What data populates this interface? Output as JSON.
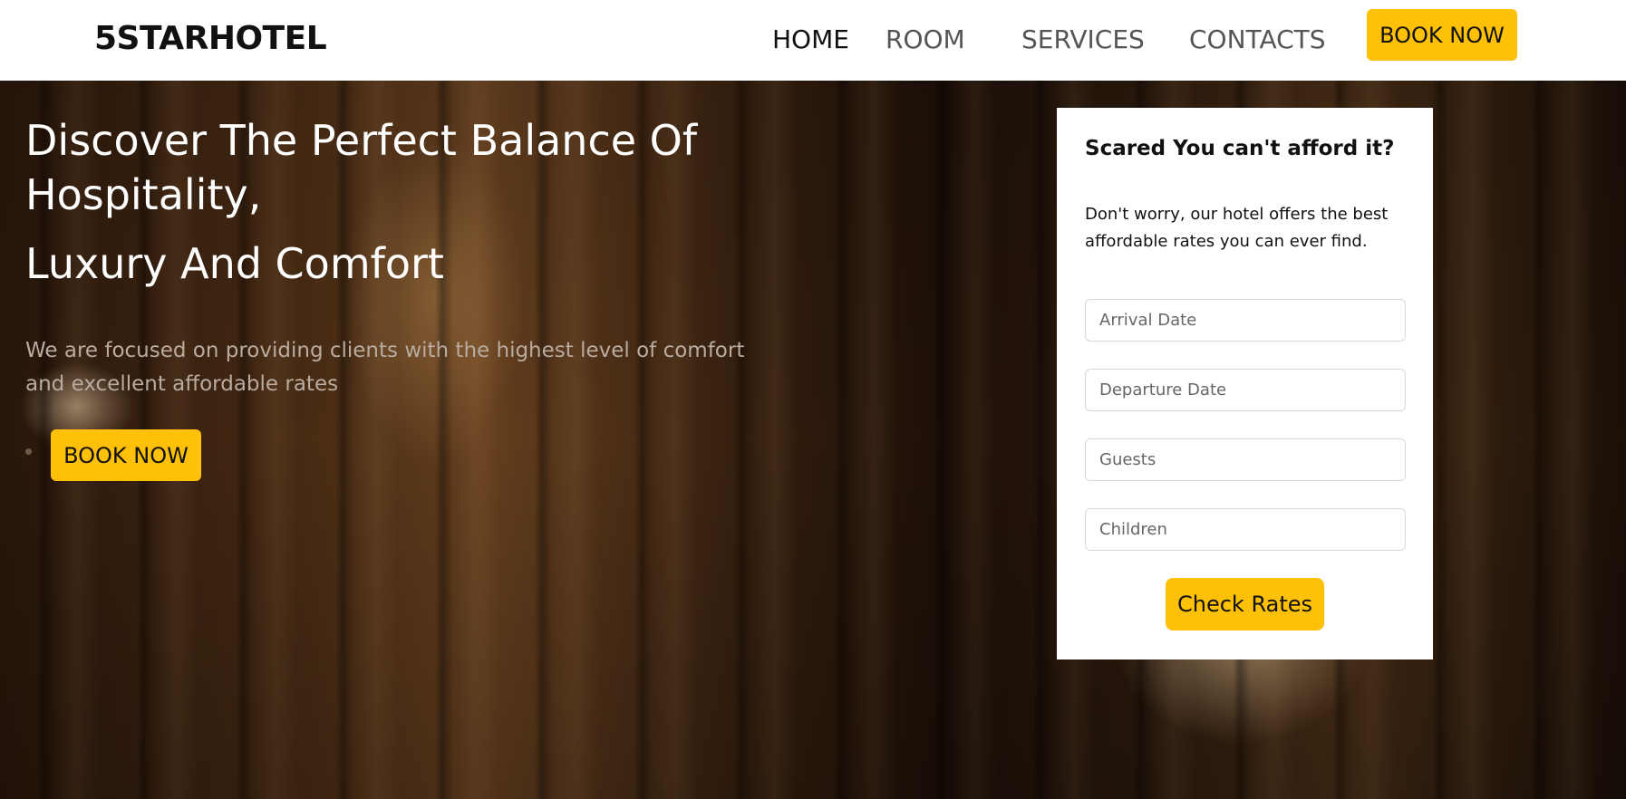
{
  "navbar": {
    "brand": "5STARHOTEL",
    "links": [
      {
        "label": "HOME",
        "active": true
      },
      {
        "label": "ROOM",
        "active": false
      },
      {
        "label": "SERVICES",
        "active": false
      },
      {
        "label": "CONTACTS",
        "active": false
      }
    ],
    "book_label": "BOOK NOW"
  },
  "hero": {
    "title_line1": "Discover The Perfect Balance Of Hospitality,",
    "title_line2": "Luxury And Comfort",
    "subtitle": "We are focused on providing clients with the highest level of comfort and excellent affordable rates",
    "book_label": "BOOK NOW"
  },
  "booking_card": {
    "title": "Scared You can't afford it?",
    "text": "Don't worry, our hotel offers the best affordable rates you can ever find.",
    "fields": {
      "arrival_placeholder": "Arrival Date",
      "departure_placeholder": "Departure Date",
      "guests_placeholder": "Guests",
      "children_placeholder": "Children"
    },
    "submit_label": "Check Rates"
  },
  "colors": {
    "accent": "#ffc107",
    "navbar_bg": "#ffffff",
    "text_dark": "#111111",
    "nav_text": "#555555"
  }
}
